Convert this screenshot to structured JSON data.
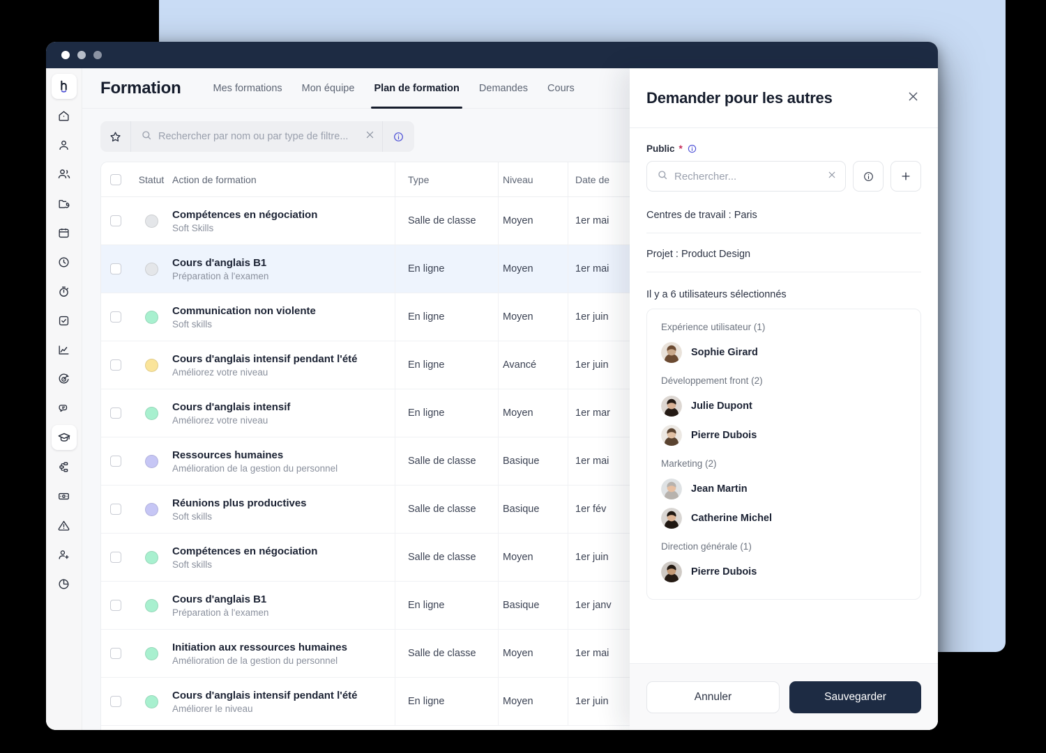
{
  "window": {
    "traffic_lights": [
      "close",
      "minimize",
      "zoom"
    ]
  },
  "sidebar": {
    "logo_name": "brand-logo",
    "items": [
      {
        "icon": "home-icon",
        "active": false
      },
      {
        "icon": "user-icon",
        "active": false
      },
      {
        "icon": "users-icon",
        "active": false
      },
      {
        "icon": "folder-icon",
        "active": false
      },
      {
        "icon": "calendar-icon",
        "active": false
      },
      {
        "icon": "clock-icon",
        "active": false
      },
      {
        "icon": "stopwatch-icon",
        "active": false
      },
      {
        "icon": "checkbox-icon",
        "active": false
      },
      {
        "icon": "chart-line-icon",
        "active": false
      },
      {
        "icon": "target-icon",
        "active": false
      },
      {
        "icon": "chat-icon",
        "active": false
      },
      {
        "icon": "graduation-cap-icon",
        "active": true
      },
      {
        "icon": "workflow-icon",
        "active": false
      },
      {
        "icon": "money-icon",
        "active": false
      },
      {
        "icon": "alert-icon",
        "active": false
      },
      {
        "icon": "user-plus-icon",
        "active": false
      },
      {
        "icon": "pie-chart-icon",
        "active": false
      }
    ]
  },
  "header": {
    "title": "Formation",
    "tabs": [
      {
        "label": "Mes formations",
        "active": false
      },
      {
        "label": "Mon équipe",
        "active": false
      },
      {
        "label": "Plan de formation",
        "active": true
      },
      {
        "label": "Demandes",
        "active": false
      },
      {
        "label": "Cours",
        "active": false
      }
    ]
  },
  "search": {
    "placeholder": "Rechercher par nom ou par type de filtre...",
    "value": "",
    "star_icon": "star-icon",
    "search_icon": "search-icon",
    "clear_icon": "close-icon",
    "info_icon": "info-icon",
    "info_color": "#4b4fd6"
  },
  "table": {
    "columns": [
      "Statut",
      "Action de formation",
      "Type",
      "Niveau",
      "Date de"
    ],
    "rows": [
      {
        "title": "Compétences en négociation",
        "subtitle": "Soft Skills",
        "type": "Salle de classe",
        "level": "Moyen",
        "date": "1er mai",
        "status_color": "#e4e6e9",
        "selected": false
      },
      {
        "title": "Cours d'anglais B1",
        "subtitle": "Préparation à l'examen",
        "type": "En ligne",
        "level": "Moyen",
        "date": "1er mai",
        "status_color": "#e4e6e9",
        "selected": true
      },
      {
        "title": "Communication non violente",
        "subtitle": "Soft skills",
        "type": "En ligne",
        "level": "Moyen",
        "date": "1er juin",
        "status_color": "#a8f0cf",
        "selected": false
      },
      {
        "title": "Cours d'anglais intensif pendant l'été",
        "subtitle": "Améliorez votre niveau",
        "type": "En ligne",
        "level": "Avancé",
        "date": "1er juin",
        "status_color": "#fae49a",
        "selected": false
      },
      {
        "title": "Cours d'anglais intensif",
        "subtitle": "Améliorez votre niveau",
        "type": "En ligne",
        "level": "Moyen",
        "date": "1er mar",
        "status_color": "#a8f0cf",
        "selected": false
      },
      {
        "title": "Ressources humaines",
        "subtitle": "Amélioration de la gestion du personnel",
        "type": "Salle de classe",
        "level": "Basique",
        "date": "1er mai",
        "status_color": "#c6c6f5",
        "selected": false
      },
      {
        "title": "Réunions plus productives",
        "subtitle": "Soft skills",
        "type": "Salle de classe",
        "level": "Basique",
        "date": "1er fév",
        "status_color": "#c6c6f5",
        "selected": false
      },
      {
        "title": "Compétences en négociation",
        "subtitle": "Soft skills",
        "type": "Salle de classe",
        "level": "Moyen",
        "date": "1er juin",
        "status_color": "#a8f0cf",
        "selected": false
      },
      {
        "title": "Cours d'anglais B1",
        "subtitle": "Préparation à l'examen",
        "type": "En ligne",
        "level": "Basique",
        "date": "1er janv",
        "status_color": "#a8f0cf",
        "selected": false
      },
      {
        "title": "Initiation aux ressources humaines",
        "subtitle": "Amélioration de la gestion du personnel",
        "type": "Salle de classe",
        "level": "Moyen",
        "date": "1er mai",
        "status_color": "#a8f0cf",
        "selected": false
      },
      {
        "title": "Cours d'anglais intensif pendant l'été",
        "subtitle": "Améliorer le niveau",
        "type": "En ligne",
        "level": "Moyen",
        "date": "1er juin",
        "status_color": "#a8f0cf",
        "selected": false
      }
    ]
  },
  "panel": {
    "title": "Demander pour les autres",
    "close_icon": "close-icon",
    "public_label": "Public",
    "required_marker": "*",
    "public_info_icon": "info-icon",
    "public_search_placeholder": "Rechercher...",
    "public_search_value": "",
    "public_clear_icon": "close-icon",
    "public_info_button_icon": "info-icon",
    "public_add_button_icon": "plus-icon",
    "meta": [
      "Centres de travail : Paris",
      "Projet : Product Design"
    ],
    "selection_summary": "Il y a 6 utilisateurs sélectionnés",
    "groups": [
      {
        "label": "Expérience utilisateur (1)",
        "people": [
          {
            "name": "Sophie Girard",
            "avatar_tone": "#c9a88a",
            "hair": "#6b4a31",
            "bg": "#e9e2da"
          }
        ]
      },
      {
        "label": "Développement front (2)",
        "people": [
          {
            "name": "Julie Dupont",
            "avatar_tone": "#d8b195",
            "hair": "#241a14",
            "bg": "#ddd7d2"
          },
          {
            "name": "Pierre Dubois",
            "avatar_tone": "#e0c0a4",
            "hair": "#5a4330",
            "bg": "#ece8e3"
          }
        ]
      },
      {
        "label": "Marketing (2)",
        "people": [
          {
            "name": "Jean Martin",
            "avatar_tone": "#e6bfa2",
            "hair": "#b7b2ad",
            "bg": "#dfe2e4"
          },
          {
            "name": "Catherine Michel",
            "avatar_tone": "#dcb394",
            "hair": "#1f1711",
            "bg": "#d9d6d3"
          }
        ]
      },
      {
        "label": "Direction générale (1)",
        "people": [
          {
            "name": "Pierre Dubois",
            "avatar_tone": "#c49a76",
            "hair": "#241a13",
            "bg": "#cfcac5"
          }
        ]
      }
    ],
    "cancel_label": "Annuler",
    "save_label": "Sauvegarder",
    "save_color": "#1d2b43"
  }
}
